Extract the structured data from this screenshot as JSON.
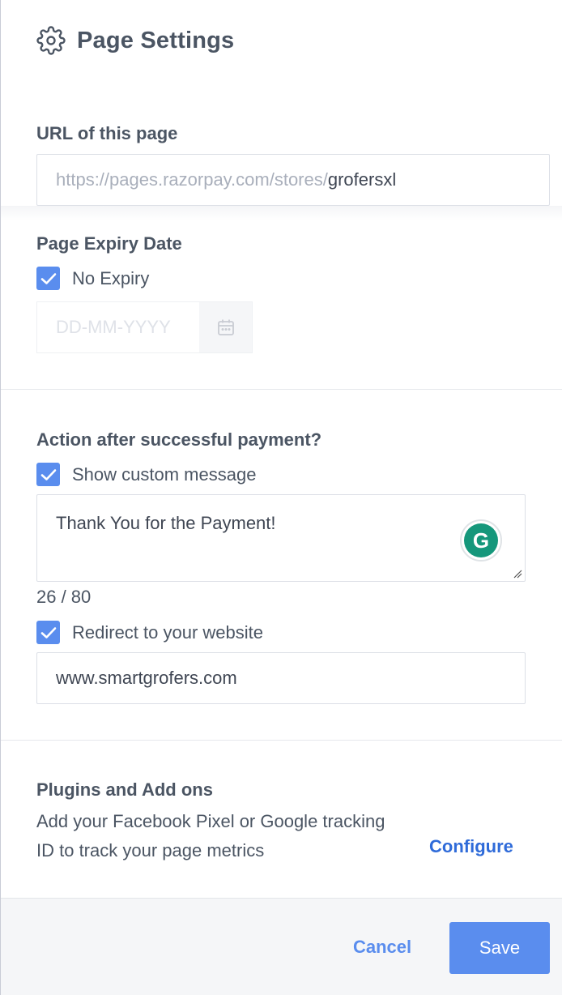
{
  "header": {
    "title": "Page Settings",
    "icon": "gear-icon"
  },
  "url_section": {
    "label": "URL of this page",
    "prefix": "https://pages.razorpay.com/stores/",
    "value": "grofersxl"
  },
  "expiry_section": {
    "label": "Page Expiry Date",
    "no_expiry_label": "No Expiry",
    "no_expiry_checked": true,
    "date_placeholder": "DD-MM-YYYY"
  },
  "action_section": {
    "label": "Action after successful payment?",
    "custom_message_label": "Show custom message",
    "custom_message_checked": true,
    "message_value": "Thank You for the Payment!",
    "char_count": "26 / 80",
    "redirect_label": "Redirect to your website",
    "redirect_checked": true,
    "website_value": "www.smartgrofers.com"
  },
  "plugins_section": {
    "label": "Plugins and Add ons",
    "description": "Add your Facebook Pixel or Google tracking ID to track your page metrics",
    "configure_label": "Configure"
  },
  "footer": {
    "cancel_label": "Cancel",
    "save_label": "Save"
  },
  "colors": {
    "accent": "#5a8dee",
    "link": "#2f6bd9",
    "grammarly": "#15977b"
  }
}
